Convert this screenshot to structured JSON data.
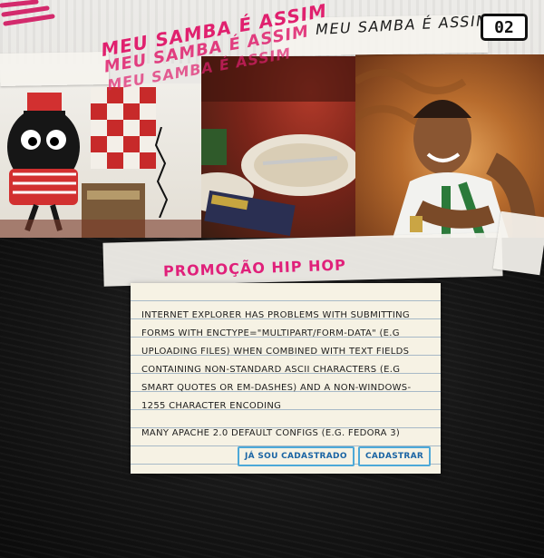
{
  "header": {
    "tag_lines": [
      "MEU SAMBA É ASSIM",
      "MEU SAMBA É ASSIM",
      "MEU SAMBA É ASSIM"
    ],
    "site_title": "MEU SAMBA É ASSIM",
    "logo_text": "02"
  },
  "promo": {
    "title": "PROMOÇÃO HIP HOP"
  },
  "card": {
    "paragraph1": "Internet Explorer has problems with submitting forms with enctype=\"multipart/form-data\" (e.g uploading files) when combined with text fields containing non-standard ASCII characters (e.g smart quotes or em-dashes) and a non-windows-1255 character encoding",
    "paragraph2": "Many Apache 2.0 default configs (e.g. Fedora 3)",
    "login_label": "JÁ SOU CADASTRADO",
    "signup_label": "CADASTRAR"
  },
  "colors": {
    "accent_pink": "#e0207a",
    "button_border": "#4da9d8",
    "button_text": "#1a64a4",
    "card_bg": "#f6f2e4"
  }
}
